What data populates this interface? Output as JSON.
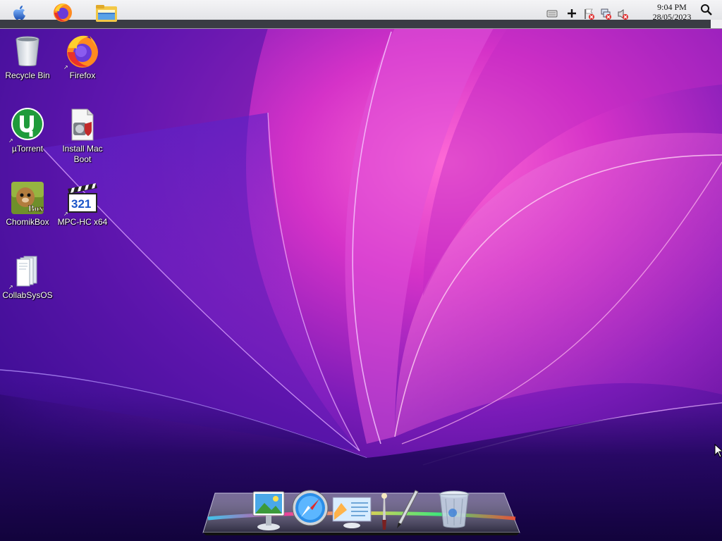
{
  "desktop": {
    "icons": [
      {
        "label": "Recycle Bin",
        "icon": "recycle-bin-icon"
      },
      {
        "label": "Firefox",
        "icon": "firefox-icon"
      },
      {
        "label": "µTorrent",
        "icon": "utorrent-icon"
      },
      {
        "label": "Install Mac Boot",
        "icon": "installer-icon"
      },
      {
        "label": "ChomikBox",
        "icon": "chomikbox-icon"
      },
      {
        "label": "MPC-HC x64",
        "icon": "mpc-hc-icon"
      },
      {
        "label": "CollabSysOS",
        "icon": "documents-icon"
      }
    ]
  },
  "topbar": {
    "apps": [
      "apple-menu-icon",
      "firefox-icon",
      "file-explorer-icon"
    ],
    "tray": [
      "keyboard-icon",
      "plus-icon",
      "flag-icon",
      "network-icon",
      "volume-muted-icon"
    ],
    "time": "9:04 PM",
    "date": "28/05/2023",
    "search_icon": "search-icon"
  },
  "dock": {
    "items": [
      "photo-viewer-icon",
      "safari-compass-icon",
      "image-notes-icon",
      "brushes-icon",
      "pen-icon",
      "trash-icon"
    ]
  },
  "colors": {
    "wallpaper_deep": "#2a0a6b",
    "wallpaper_magenta": "#e23bd8",
    "wallpaper_pink": "#ff57c8"
  }
}
